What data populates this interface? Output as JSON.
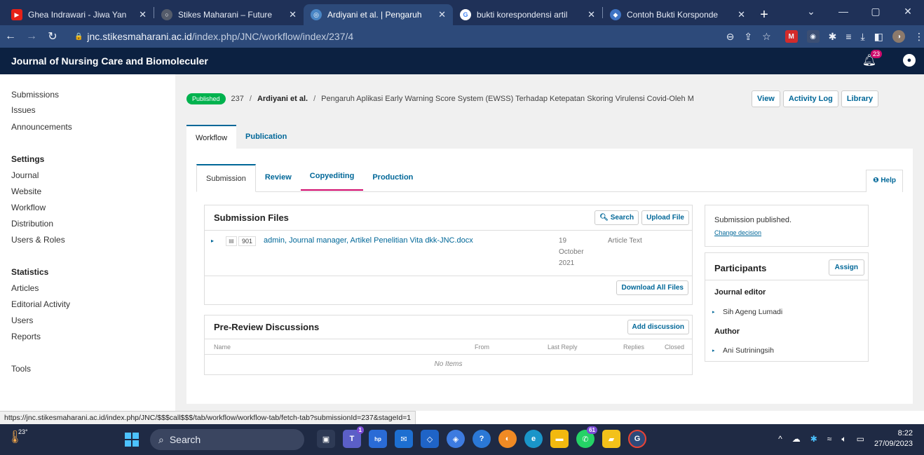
{
  "browser": {
    "tabs": [
      {
        "title": "Ghea Indrawari - Jiwa Yan",
        "fav": "▶",
        "fav_color": "#e62117"
      },
      {
        "title": "Stikes Maharani – Future",
        "fav": "○",
        "fav_color": "#555c6b"
      },
      {
        "title": "Ardiyani et al. | Pengaruh",
        "fav": "◎",
        "fav_color": "#4a86c5"
      },
      {
        "title": "bukti korespondensi artil",
        "fav": "G",
        "fav_color": "#ffffff"
      },
      {
        "title": "Contoh Bukti Korsponde",
        "fav": "◆",
        "fav_color": "#3f74c4"
      }
    ],
    "new_tab": "+",
    "url_host": "jnc.stikesmaharani.ac.id",
    "url_path": "/index.php/JNC/workflow/index/237/4"
  },
  "header": {
    "site_title": "Journal of Nursing Care and Biomoleculer",
    "notifications": "23"
  },
  "sidebar": {
    "links": [
      "Submissions",
      "Issues",
      "Announcements"
    ],
    "settings_heading": "Settings",
    "settings": [
      "Journal",
      "Website",
      "Workflow",
      "Distribution",
      "Users & Roles"
    ],
    "statistics_heading": "Statistics",
    "statistics": [
      "Articles",
      "Editorial Activity",
      "Users",
      "Reports"
    ],
    "tools": "Tools"
  },
  "submission": {
    "status": "Published",
    "id": "237",
    "author": "Ardiyani et al.",
    "title": "Pengaruh Aplikasi Early Warning Score System (EWSS) Terhadap Ketepatan Skoring Virulensi Covid-Oleh M",
    "actions": [
      "View",
      "Activity Log",
      "Library"
    ]
  },
  "tabs": {
    "main": [
      "Workflow",
      "Publication"
    ],
    "stages": [
      "Submission",
      "Review",
      "Copyediting",
      "Production"
    ],
    "help": "Help"
  },
  "files": {
    "heading": "Submission Files",
    "search": "Search",
    "upload": "Upload File",
    "row": {
      "file_id": "901",
      "name": "admin, Journal manager, Artikel Penelitian Vita dkk-JNC.docx",
      "date_line1": "19",
      "date_line2": "October",
      "date_line3": "2021",
      "type": "Article Text"
    },
    "download_all": "Download All Files"
  },
  "discussions": {
    "heading": "Pre-Review Discussions",
    "add": "Add discussion",
    "columns": [
      "Name",
      "From",
      "Last Reply",
      "Replies",
      "Closed"
    ],
    "empty": "No Items"
  },
  "decision": {
    "text": "Submission published.",
    "change": "Change decision"
  },
  "participants": {
    "heading": "Participants",
    "assign": "Assign",
    "editor_role": "Journal editor",
    "editor": "Sih Ageng Lumadi",
    "author_role": "Author",
    "author": "Ani Sutriningsih"
  },
  "status_url": "https://jnc.stikesmaharani.ac.id/index.php/JNC/$$$call$$$/tab/workflow/workflow-tab/fetch-tab?submissionId=237&stageId=1",
  "taskbar": {
    "temperature": "23°",
    "search": "Search",
    "time": "8:22",
    "date": "27/09/2023",
    "teams_count": "1",
    "whatsapp_count": "61"
  }
}
